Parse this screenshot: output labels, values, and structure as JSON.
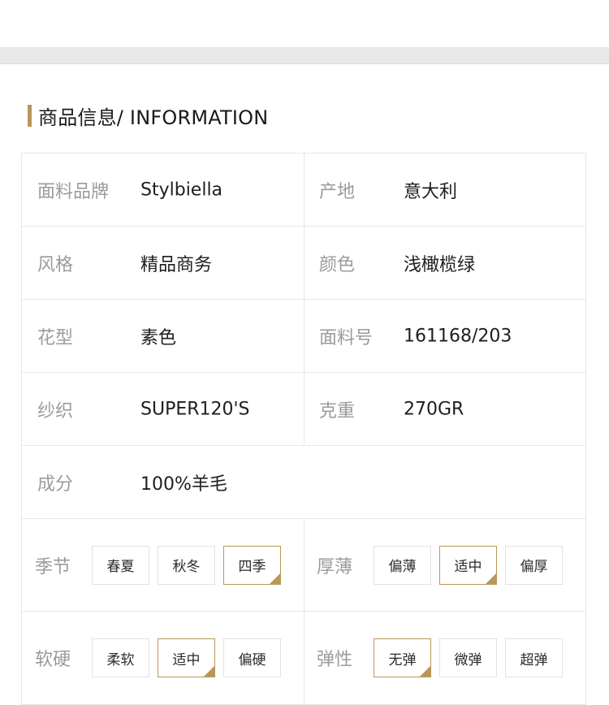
{
  "section": {
    "title": "商品信息/ INFORMATION"
  },
  "colors": {
    "accent": "#b9975b",
    "label": "#9b9b9b",
    "value": "#1e1e1e",
    "border": "#e6e6e6"
  },
  "specs": {
    "fabric_brand": {
      "label": "面料品牌",
      "value": "Stylbiella"
    },
    "origin": {
      "label": "产地",
      "value": "意大利"
    },
    "style": {
      "label": "风格",
      "value": "精品商务"
    },
    "color": {
      "label": "颜色",
      "value": "浅橄榄绿"
    },
    "pattern": {
      "label": "花型",
      "value": "素色"
    },
    "fabric_no": {
      "label": "面料号",
      "value": "161168/203"
    },
    "yarn": {
      "label": "纱织",
      "value": "SUPER120'S"
    },
    "weight": {
      "label": "克重",
      "value": "270GR"
    },
    "composition": {
      "label": "成分",
      "value": "100%羊毛"
    }
  },
  "options": {
    "season": {
      "label": "季节",
      "items": [
        "春夏",
        "秋冬",
        "四季"
      ],
      "selected": "四季"
    },
    "thickness": {
      "label": "厚薄",
      "items": [
        "偏薄",
        "适中",
        "偏厚"
      ],
      "selected": "适中"
    },
    "softness": {
      "label": "软硬",
      "items": [
        "柔软",
        "适中",
        "偏硬"
      ],
      "selected": "适中"
    },
    "elasticity": {
      "label": "弹性",
      "items": [
        "无弹",
        "微弹",
        "超弹"
      ],
      "selected": "无弹"
    }
  }
}
